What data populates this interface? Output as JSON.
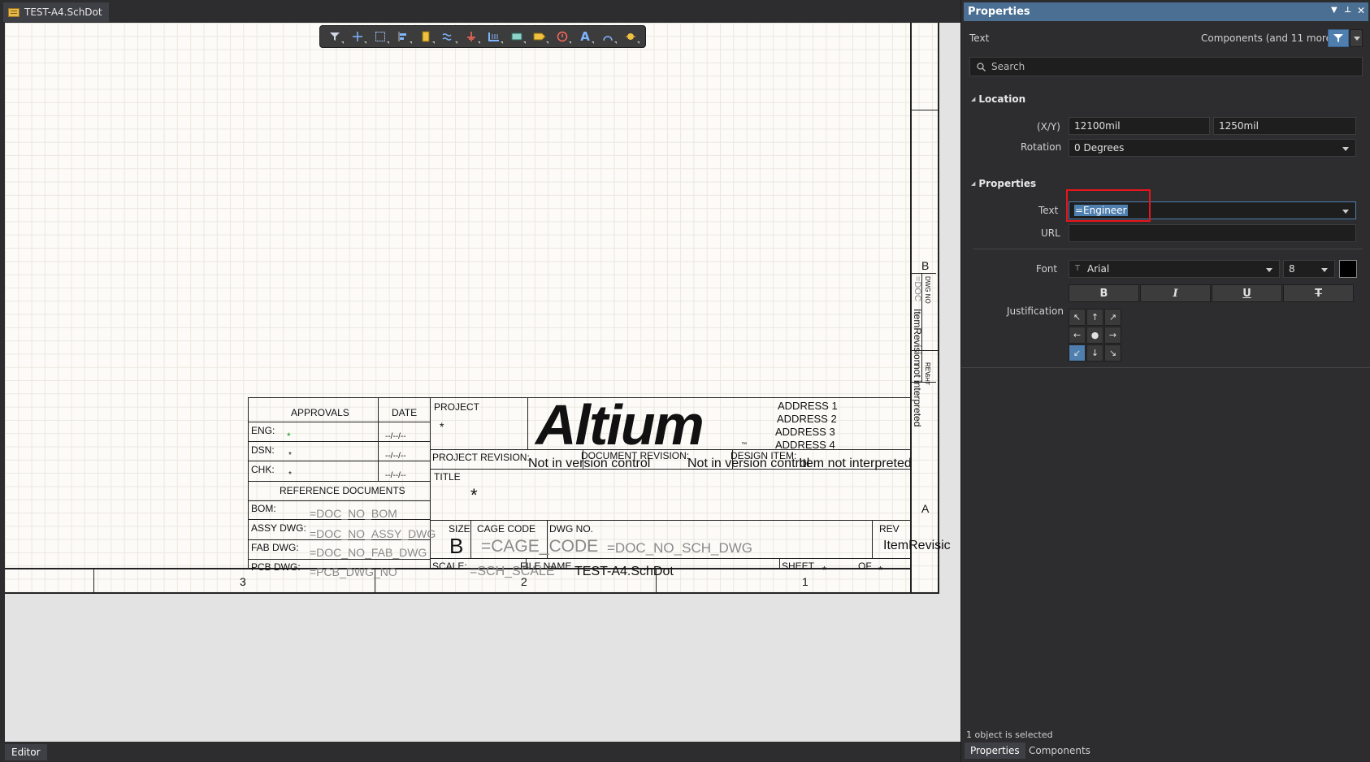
{
  "document_tab": {
    "title": "TEST-A4.SchDot"
  },
  "toolbar": {
    "tools": [
      "filter-icon",
      "cross-probe-icon",
      "select-rect-icon",
      "align-icon",
      "place-part-icon",
      "wire-icon",
      "power-port-icon",
      "bus-icon",
      "sheet-symbol-icon",
      "port-icon",
      "directive-icon",
      "text-string-icon",
      "arc-icon",
      "highlight-icon"
    ]
  },
  "schematic": {
    "zones": {
      "bottom": [
        "3",
        "2",
        "1"
      ],
      "right": [
        "B",
        "A"
      ]
    },
    "approvals": {
      "header": "APPROVALS",
      "date_header": "DATE",
      "rows": [
        {
          "label": "ENG:",
          "value": "*",
          "date": "--/--/--"
        },
        {
          "label": "DSN:",
          "value": "*",
          "date": "--/--/--"
        },
        {
          "label": "CHK:",
          "value": "*",
          "date": "--/--/--"
        }
      ]
    },
    "reference_documents": {
      "header": "REFERENCE DOCUMENTS",
      "rows": [
        {
          "label": "BOM:",
          "value": "=DOC_NO_BOM"
        },
        {
          "label": "ASSY DWG:",
          "value": "=DOC_NO_ASSY_DWG"
        },
        {
          "label": "FAB DWG:",
          "value": "=DOC_NO_FAB_DWG"
        },
        {
          "label": "PCB DWG:",
          "value": "=PCB_DWG_NO"
        }
      ]
    },
    "project": {
      "label": "PROJECT",
      "value": "*"
    },
    "logo_text": "Altium",
    "trademark": "™",
    "address": [
      "ADDRESS 1",
      "ADDRESS 2",
      "ADDRESS 3",
      "ADDRESS 4"
    ],
    "project_revision": {
      "label": "PROJECT REVISION:",
      "value": "Not in version control"
    },
    "document_revision": {
      "label": "DOCUMENT REVISION:",
      "value": "Not in version control"
    },
    "design_item": {
      "label": "DESIGN ITEM:",
      "value": "Item not interpreted"
    },
    "title": {
      "label": "TITLE",
      "value": "*"
    },
    "size": {
      "label": "SIZE",
      "value": "B"
    },
    "cage_code": {
      "label": "CAGE CODE",
      "value": "=CAGE_CODE"
    },
    "dwg_no": {
      "label": "DWG NO.",
      "value": "=DOC_NO_SCH_DWG"
    },
    "rev": {
      "label": "REV",
      "value": "ItemRevisic"
    },
    "scale": {
      "label": "SCALE:",
      "value": "=SCH_SCALE"
    },
    "file_name": {
      "label": "FILE NAME",
      "value": "TEST-A4.SchDot"
    },
    "sheet": {
      "label": "SHEET",
      "value": "*",
      "of_label": "OF",
      "of_value": "*"
    },
    "side_strip": {
      "dwg_no_label": "DWG NO",
      "doc_value": "=DOC",
      "item_revision": "ItemRevision",
      "not_interpreted": "not interpreted",
      "rev_label": "REV",
      "sht_label": "SHT"
    }
  },
  "bottom_bar": {
    "editor_tab": "Editor"
  },
  "panel": {
    "title": "Properties",
    "object_kind": "Text",
    "filter_summary": "Components (and 11 more)",
    "search_placeholder": "Search",
    "location": {
      "section": "Location",
      "xy_label": "(X/Y)",
      "x": "12100mil",
      "y": "1250mil",
      "rotation_label": "Rotation",
      "rotation": "0 Degrees"
    },
    "properties": {
      "section": "Properties",
      "text_label": "Text",
      "text_value": "=Engineer",
      "url_label": "URL",
      "url_value": "",
      "font_label": "Font",
      "font_family": "Arial",
      "font_size": "8",
      "font_color": "#000000",
      "format_buttons": [
        "B",
        "I",
        "U",
        "T"
      ],
      "justification_label": "Justification",
      "justification": [
        "↖",
        "↑",
        "↗",
        "←",
        "●",
        "→",
        "↙",
        "↓",
        "↘"
      ],
      "justification_selected": 6
    },
    "status": "1 object is selected",
    "tabs": [
      "Properties",
      "Components"
    ],
    "highlight_color": "#e8141c"
  }
}
